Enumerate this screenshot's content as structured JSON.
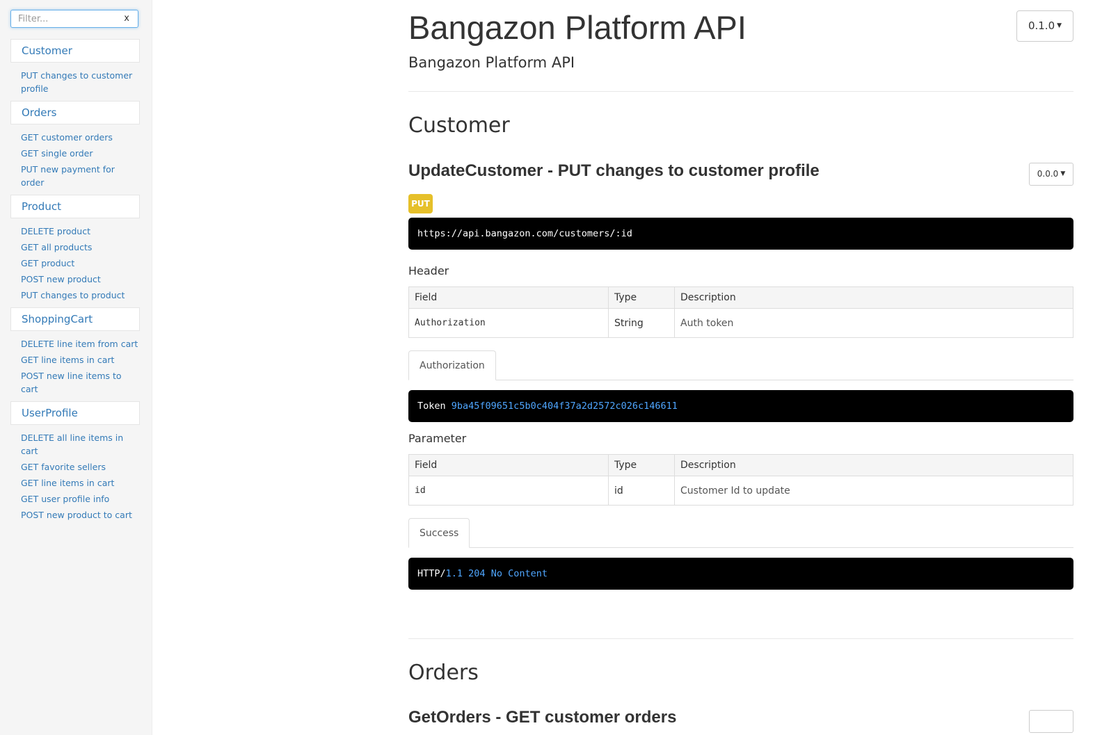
{
  "sidebar": {
    "filter": {
      "placeholder": "Filter...",
      "value": "",
      "clear_label": "x"
    },
    "groups": [
      {
        "label": "Customer",
        "items": [
          "PUT changes to customer profile"
        ]
      },
      {
        "label": "Orders",
        "items": [
          "GET customer orders",
          "GET single order",
          "PUT new payment for order"
        ]
      },
      {
        "label": "Product",
        "items": [
          "DELETE product",
          "GET all products",
          "GET product",
          "POST new product",
          "PUT changes to product"
        ]
      },
      {
        "label": "ShoppingCart",
        "items": [
          "DELETE line item from cart",
          "GET line items in cart",
          "POST new line items to cart"
        ]
      },
      {
        "label": "UserProfile",
        "items": [
          "DELETE all line items in cart",
          "GET favorite sellers",
          "GET line items in cart",
          "GET user profile info",
          "POST new product to cart"
        ]
      }
    ]
  },
  "header": {
    "title": "Bangazon Platform API",
    "subtitle": "Bangazon Platform API",
    "version_label": "0.1.0"
  },
  "sections": [
    {
      "title": "Customer",
      "endpoint": {
        "title": "UpdateCustomer - PUT changes to customer profile",
        "version_label": "0.0.0",
        "method": "PUT",
        "url": "https://api.bangazon.com/customers/:id",
        "header_label": "Header",
        "header_table": {
          "columns": [
            "Field",
            "Type",
            "Description"
          ],
          "rows": [
            [
              "Authorization",
              "String",
              "Auth token"
            ]
          ]
        },
        "auth_tab": "Authorization",
        "auth_example": {
          "prefix": "Token",
          "value": "9ba45f09651c5b0c404f37a2d2572c026c146611"
        },
        "parameter_label": "Parameter",
        "parameter_table": {
          "columns": [
            "Field",
            "Type",
            "Description"
          ],
          "rows": [
            [
              "id",
              "id",
              "Customer Id to update"
            ]
          ]
        },
        "success_tab": "Success",
        "success_example": {
          "prefix": "HTTP/",
          "version": "1.1",
          "status": "204",
          "message": "No Content"
        }
      }
    },
    {
      "title": "Orders",
      "endpoint": {
        "title": "GetOrders - GET customer orders"
      }
    }
  ],
  "colors": {
    "link": "#337ab7",
    "put_badge": "#e6c02a",
    "code_bg": "#000000",
    "code_accent": "#4fa6ff",
    "sidebar_bg": "#f5f5f5"
  },
  "icons": {
    "dropdown": "caret-down-icon"
  }
}
